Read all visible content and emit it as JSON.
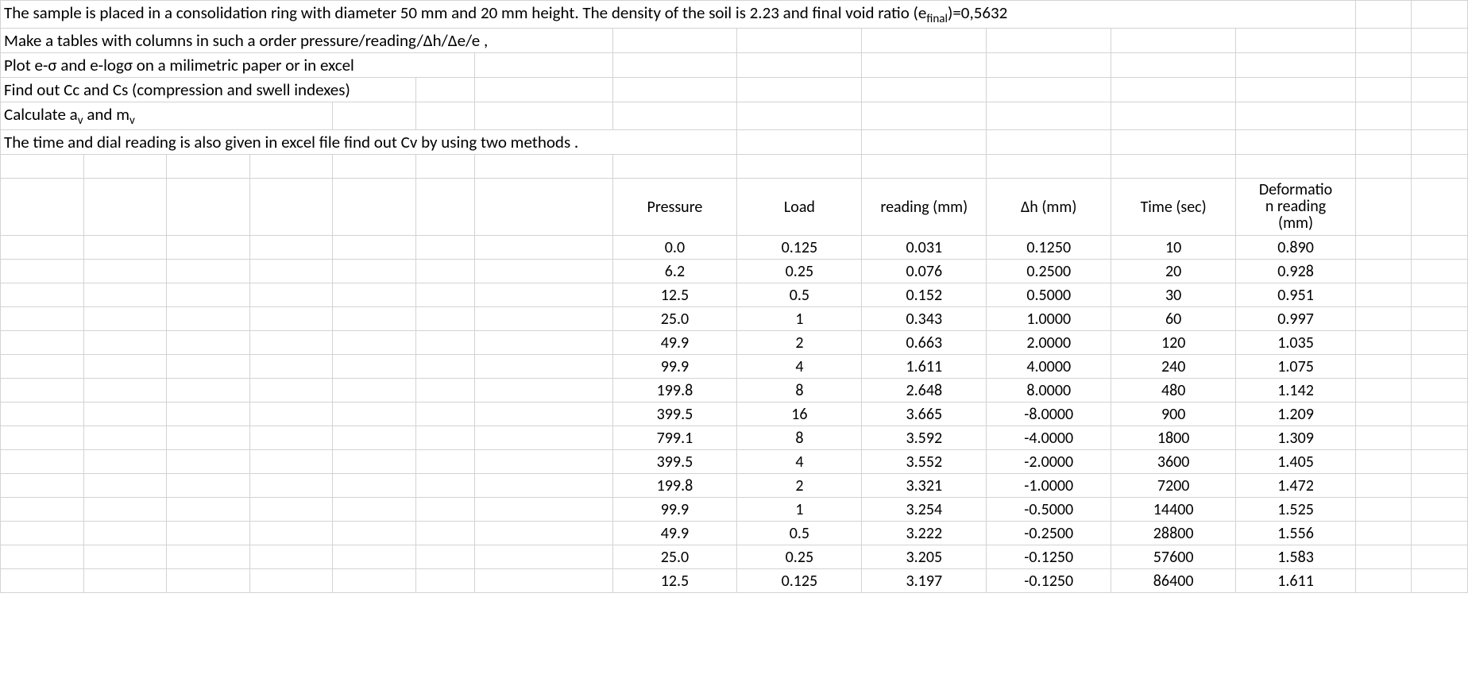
{
  "instructions": {
    "line1a": "The sample is placed in a consolidation ring with diameter 50 mm and 20 mm height. The density of the soil is 2.23 and final void ratio (e",
    "line1b": ")=0,5632",
    "line1_sub": "final",
    "line2": "Make a tables with columns in such a order  pressure/reading/Δh/Δe/e ,",
    "line3": "Plot e-σ and e-logσ  on a milimetric paper or in excel",
    "line4": "Find out Cc and Cs (compression and swell indexes)",
    "line5a": " Calculate a",
    "line5b": " and m",
    "line5_sub": "v",
    "line6": " The time and dial reading is also given in excel file find out Cv by using two methods ."
  },
  "headers": {
    "pressure": "Pressure",
    "load": "Load",
    "reading": "reading (mm)",
    "dh": "Δh (mm)",
    "time": "Time (sec)",
    "deform1": "Deformatio",
    "deform2": "n reading",
    "deform3": "(mm)"
  },
  "rows": [
    {
      "pressure": "0.0",
      "load": "0.125",
      "reading": "0.031",
      "dh": "0.1250",
      "time": "10",
      "deform": "0.890"
    },
    {
      "pressure": "6.2",
      "load": "0.25",
      "reading": "0.076",
      "dh": "0.2500",
      "time": "20",
      "deform": "0.928"
    },
    {
      "pressure": "12.5",
      "load": "0.5",
      "reading": "0.152",
      "dh": "0.5000",
      "time": "30",
      "deform": "0.951"
    },
    {
      "pressure": "25.0",
      "load": "1",
      "reading": "0.343",
      "dh": "1.0000",
      "time": "60",
      "deform": "0.997"
    },
    {
      "pressure": "49.9",
      "load": "2",
      "reading": "0.663",
      "dh": "2.0000",
      "time": "120",
      "deform": "1.035"
    },
    {
      "pressure": "99.9",
      "load": "4",
      "reading": "1.611",
      "dh": "4.0000",
      "time": "240",
      "deform": "1.075"
    },
    {
      "pressure": "199.8",
      "load": "8",
      "reading": "2.648",
      "dh": "8.0000",
      "time": "480",
      "deform": "1.142"
    },
    {
      "pressure": "399.5",
      "load": "16",
      "reading": "3.665",
      "dh": "-8.0000",
      "time": "900",
      "deform": "1.209"
    },
    {
      "pressure": "799.1",
      "load": "8",
      "reading": "3.592",
      "dh": "-4.0000",
      "time": "1800",
      "deform": "1.309"
    },
    {
      "pressure": "399.5",
      "load": "4",
      "reading": "3.552",
      "dh": "-2.0000",
      "time": "3600",
      "deform": "1.405"
    },
    {
      "pressure": "199.8",
      "load": "2",
      "reading": "3.321",
      "dh": "-1.0000",
      "time": "7200",
      "deform": "1.472"
    },
    {
      "pressure": "99.9",
      "load": "1",
      "reading": "3.254",
      "dh": "-0.5000",
      "time": "14400",
      "deform": "1.525"
    },
    {
      "pressure": "49.9",
      "load": "0.5",
      "reading": "3.222",
      "dh": "-0.2500",
      "time": "28800",
      "deform": "1.556"
    },
    {
      "pressure": "25.0",
      "load": "0.25",
      "reading": "3.205",
      "dh": "-0.1250",
      "time": "57600",
      "deform": "1.583"
    },
    {
      "pressure": "12.5",
      "load": "0.125",
      "reading": "3.197",
      "dh": "-0.1250",
      "time": "86400",
      "deform": "1.611"
    }
  ]
}
